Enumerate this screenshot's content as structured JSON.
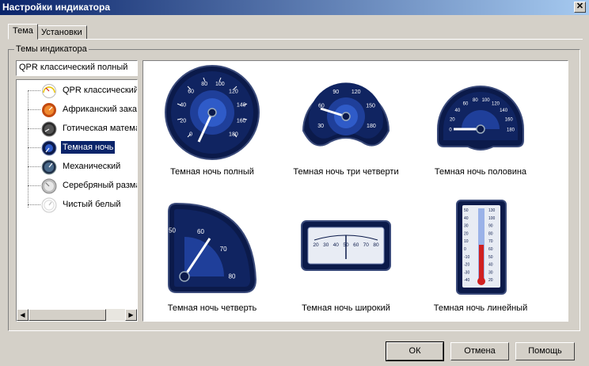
{
  "window": {
    "title": "Настройки индикатора",
    "close_glyph": "✕"
  },
  "tabs": [
    {
      "label": "Тема"
    },
    {
      "label": "Установки"
    }
  ],
  "group": {
    "label": "Темы индикатора"
  },
  "theme_select": {
    "value": "QPR классический полный"
  },
  "tree": {
    "items": [
      {
        "label": "QPR классический",
        "icon": "classic-gauge-icon"
      },
      {
        "label": "Африканский закат",
        "icon": "african-gauge-icon"
      },
      {
        "label": "Готическая математика",
        "icon": "gothic-gauge-icon"
      },
      {
        "label": "Темная ночь",
        "icon": "dark-night-gauge-icon",
        "selected": true
      },
      {
        "label": "Механический",
        "icon": "mechanical-gauge-icon"
      },
      {
        "label": "Серебряный размах",
        "icon": "silver-gauge-icon"
      },
      {
        "label": "Чистый белый",
        "icon": "white-gauge-icon"
      }
    ]
  },
  "gallery": {
    "items": [
      {
        "label": "Темная ночь полный"
      },
      {
        "label": "Темная ночь три четверти"
      },
      {
        "label": "Темная ночь половина"
      },
      {
        "label": "Темная ночь четверть"
      },
      {
        "label": "Темная ночь широкий"
      },
      {
        "label": "Темная ночь линейный"
      }
    ],
    "ticks": {
      "full": [
        "0",
        "20",
        "40",
        "60",
        "80",
        "100",
        "120",
        "140",
        "160",
        "180"
      ],
      "three_quarter": [
        "30",
        "60",
        "90",
        "120",
        "150",
        "180"
      ],
      "half": [
        "0",
        "20",
        "40",
        "60",
        "80",
        "100",
        "120",
        "140",
        "160",
        "180"
      ],
      "quarter": [
        "50",
        "60",
        "70",
        "80"
      ],
      "wide": [
        "20",
        "30",
        "40",
        "50",
        "60",
        "70",
        "80"
      ],
      "linear_left": [
        "50",
        "40",
        "30",
        "20",
        "10",
        "0",
        "-10",
        "-20",
        "-30",
        "-40"
      ],
      "linear_right": [
        "130",
        "100",
        "90",
        "80",
        "70",
        "60",
        "50",
        "40",
        "30",
        "20"
      ]
    }
  },
  "buttons": {
    "ok": "ОК",
    "cancel": "Отмена",
    "help": "Помощь"
  },
  "colors": {
    "title_start": "#0a246a",
    "title_end": "#a6caf0",
    "gauge_dark": "#0b1a4a",
    "gauge_mid": "#1f3f9a",
    "selection": "#0a246a"
  }
}
